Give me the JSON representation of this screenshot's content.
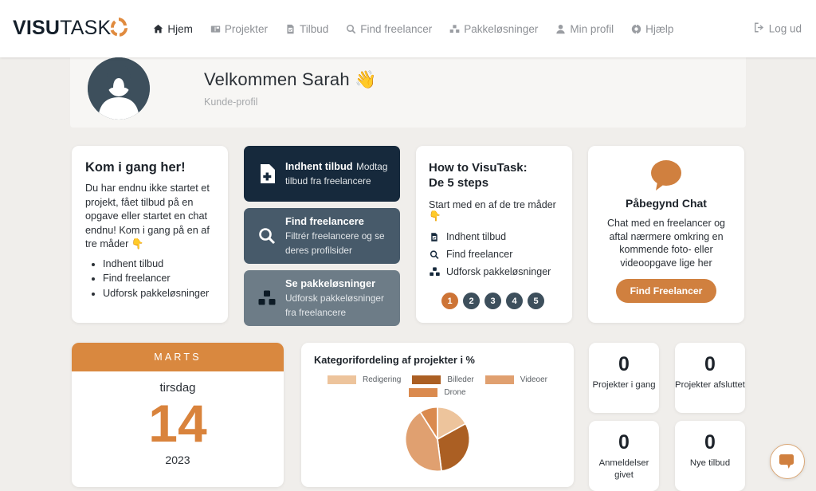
{
  "navbar": {
    "brand_bold": "VISU",
    "brand_light": "TASK",
    "links": [
      {
        "label": "Hjem",
        "icon": "home-icon",
        "active": true
      },
      {
        "label": "Projekter",
        "icon": "projects-icon",
        "active": false
      },
      {
        "label": "Tilbud",
        "icon": "offer-document-icon",
        "active": false
      },
      {
        "label": "Find freelancer",
        "icon": "search-icon",
        "active": false
      },
      {
        "label": "Pakkeløsninger",
        "icon": "boxes-icon",
        "active": false
      },
      {
        "label": "Min profil",
        "icon": "user-icon",
        "active": false
      },
      {
        "label": "Hjælp",
        "icon": "lifebuoy-icon",
        "active": false
      }
    ],
    "logout_label": "Log ud",
    "logout_icon": "sign-out-icon"
  },
  "welcome": {
    "title": "Velkommen Sarah 👋",
    "subtitle": "Kunde-profil",
    "avatar_icon": "user-avatar-placeholder"
  },
  "get_started_card": {
    "title": "Kom i gang her!",
    "body": "Du har endnu ikke startet et projekt, fået tilbud på en opgave eller startet en chat endnu! Kom i gang på en af tre måder 👇",
    "items": [
      "Indhent tilbud",
      "Find freelancer",
      "Udforsk pakkeløsninger"
    ]
  },
  "actions": [
    {
      "title": "Indhent tilbud",
      "desc": "Modtag tilbud fra freelancere",
      "icon": "file-plus-icon",
      "color": "#16293c"
    },
    {
      "title": "Find freelancere",
      "desc": "Filtrér freelancere og se deres profilsider",
      "icon": "search-icon",
      "color": "#475a6a"
    },
    {
      "title": "Se pakkeløsninger",
      "desc": "Udforsk pakkeløsninger fra freelancere",
      "icon": "boxes-icon",
      "color": "#6d7c87"
    }
  ],
  "howto_card": {
    "title_line1": "How to VisuTask:",
    "title_line2": "De 5 steps",
    "lead": "Start med en af de tre måder 👇",
    "steps": [
      {
        "label": "Indhent tilbud",
        "icon": "offer-document-icon"
      },
      {
        "label": "Find freelancer",
        "icon": "search-icon"
      },
      {
        "label": "Udforsk pakkeløsninger",
        "icon": "boxes-icon"
      }
    ],
    "pager": [
      "1",
      "2",
      "3",
      "4",
      "5"
    ],
    "pager_active_index": 0,
    "pager_active_color": "#cd7436",
    "pager_color": "#3d4f5c"
  },
  "chat_card": {
    "icon": "chat-bubble-icon",
    "title": "Påbegynd Chat",
    "body": "Chat med en freelancer og aftal nærmere omkring en kommende foto- eller videoopgave lige her",
    "button_label": "Find Freelancer",
    "button_color": "#d0803f"
  },
  "calendar": {
    "month": "MARTS",
    "weekday": "tirsdag",
    "day": "14",
    "year": "2023",
    "header_color": "#d9883f",
    "day_color": "#d9833c"
  },
  "chart_data": {
    "type": "pie",
    "title": "Kategorifordeling af projekter i %",
    "labels": [
      "Redigering",
      "Billeder",
      "Videoer",
      "Drone"
    ],
    "values": [
      17,
      31,
      43,
      9
    ],
    "colors": [
      "#edc49c",
      "#ab5f23",
      "#e0a070",
      "#da8a4e"
    ],
    "legend_position": "top",
    "unit": "%"
  },
  "stats": [
    {
      "value": "0",
      "label": "Projekter i gang"
    },
    {
      "value": "0",
      "label": "Projekter afsluttet"
    },
    {
      "value": "0",
      "label": "Anmeldelser givet"
    },
    {
      "value": "0",
      "label": "Nye tilbud"
    }
  ],
  "fab": {
    "icon": "chat-bubble-icon",
    "color": "#d0803f"
  }
}
